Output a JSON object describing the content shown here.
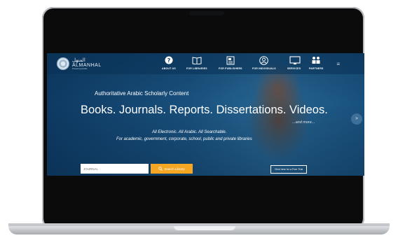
{
  "brand": {
    "arabic": "المنهل",
    "name": "ALMANHAL",
    "tagline": "Powering Arabic"
  },
  "nav": {
    "items": [
      {
        "label": "ABOUT US",
        "icon": "info-icon"
      },
      {
        "label": "FOR LIBRARIES",
        "icon": "book-icon"
      },
      {
        "label": "FOR PUBLISHERS",
        "icon": "document-icon"
      },
      {
        "label": "FOR INDIVIDUALS",
        "icon": "user-icon"
      },
      {
        "label": "SERVICES",
        "icon": "monitor-icon"
      },
      {
        "label": "PARTNERS",
        "icon": "people-icon"
      }
    ]
  },
  "hero": {
    "headline": "Authoritative Arabic Scholarly Content",
    "big": "Books. Journals. Reports. Dissertations. Videos.",
    "more": "...and more...",
    "sub1": "All Electronic. All Arabic. All Searchable.",
    "sub2": "For academic, government, corporate, school, public and private libraries",
    "next": ">"
  },
  "search": {
    "placeholder": "JOURNAL",
    "button": "Search Library"
  },
  "trial": {
    "label": "Click here for a Free Trial"
  },
  "colors": {
    "accent": "#f5a623",
    "nav_bg": "#0a3255"
  }
}
